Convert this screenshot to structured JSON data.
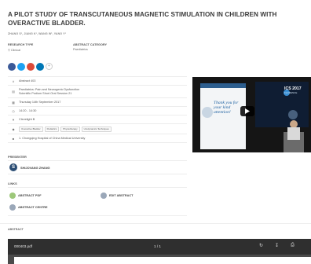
{
  "title": "A PILOT STUDY OF TRANSCUTANEOUS MAGNETIC STIMULATION IN CHILDREN WITH OVERACTIVE BLADDER.",
  "authors": "ZHANG S¹, JIANG K¹, WANG W¹, YANG Y¹",
  "meta": {
    "type_label": "RESEARCH TYPE",
    "type_value": "Clinical",
    "category_label": "ABSTRACT CATEGORY",
    "category_value": "Paediatrics"
  },
  "share": {
    "icons": [
      "facebook-icon",
      "twitter-icon",
      "google-plus-icon",
      "linkedin-icon"
    ],
    "more": "+",
    "colors": [
      "#3b5998",
      "#1da1f2",
      "#dd4b39",
      "#0077b5"
    ]
  },
  "info": {
    "abstract_no": "Abstract 403",
    "session": "Paediatrics: Pain and Neurogenic Dysfunction",
    "session_sub": "Scientific Podium Short Oral Session 21",
    "date": "Thursday 14th September 2017",
    "time": "14:20 - 14:30",
    "location": "Clevelight B",
    "tags": [
      "Overactive Bladder",
      "Pediatrics",
      "Physiotherapy",
      "Urodynamics Techniques"
    ],
    "institution": "1. Chongqing Hospital of China Medical University"
  },
  "presenter": {
    "heading": "PRESENTER",
    "initial": "S",
    "name": "SHIJOVANG ZHANG"
  },
  "links": {
    "heading": "LINKS",
    "abstract_pdf": "ABSTRACT PDF",
    "edit_abstract": "EDIT ABSTRACT",
    "abstract_centre": "ABSTRACT CENTRE"
  },
  "video": {
    "slide_text": "Thank you for your kind attention!",
    "event_label": "ICS 2017",
    "event_place": "FLORENCE"
  },
  "abstract_label": "ABSTRACT",
  "pdf": {
    "filename": "000403.pdf",
    "page": "1 / 1"
  }
}
